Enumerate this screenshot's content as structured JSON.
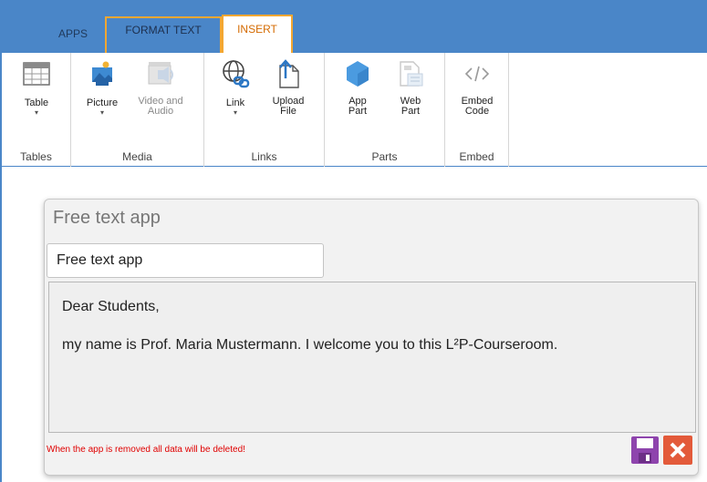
{
  "tabs": {
    "apps": "APPS",
    "format_text": "FORMAT TEXT",
    "insert": "INSERT"
  },
  "ribbon": {
    "groups": {
      "tables": "Tables",
      "media": "Media",
      "links": "Links",
      "parts": "Parts",
      "embed": "Embed"
    },
    "buttons": {
      "table": "Table",
      "picture": "Picture",
      "video_audio_1": "Video and",
      "video_audio_2": "Audio",
      "link": "Link",
      "upload_1": "Upload",
      "upload_2": "File",
      "app_part_1": "App",
      "app_part_2": "Part",
      "web_part_1": "Web",
      "web_part_2": "Part",
      "embed_1": "Embed",
      "embed_2": "Code"
    },
    "icons": [
      "table-icon",
      "picture-icon",
      "video-audio-icon",
      "link-icon",
      "upload-file-icon",
      "app-part-icon",
      "web-part-icon",
      "embed-code-icon"
    ]
  },
  "app": {
    "title": "Free text app",
    "title_input_value": "Free text app",
    "body_line1": "Dear Students,",
    "body_line2": "my name is Prof. Maria Mustermann. I welcome you to this L²P-Courseroom.",
    "warning": "When the app is removed all data will be deleted!"
  },
  "colors": {
    "tab_strip": "#4a86c8",
    "active_tab_border": "#f3a732",
    "insert_tab_text": "#d46a00",
    "save": "#8e44ad",
    "close": "#e35a3a",
    "warning": "#e00000"
  }
}
